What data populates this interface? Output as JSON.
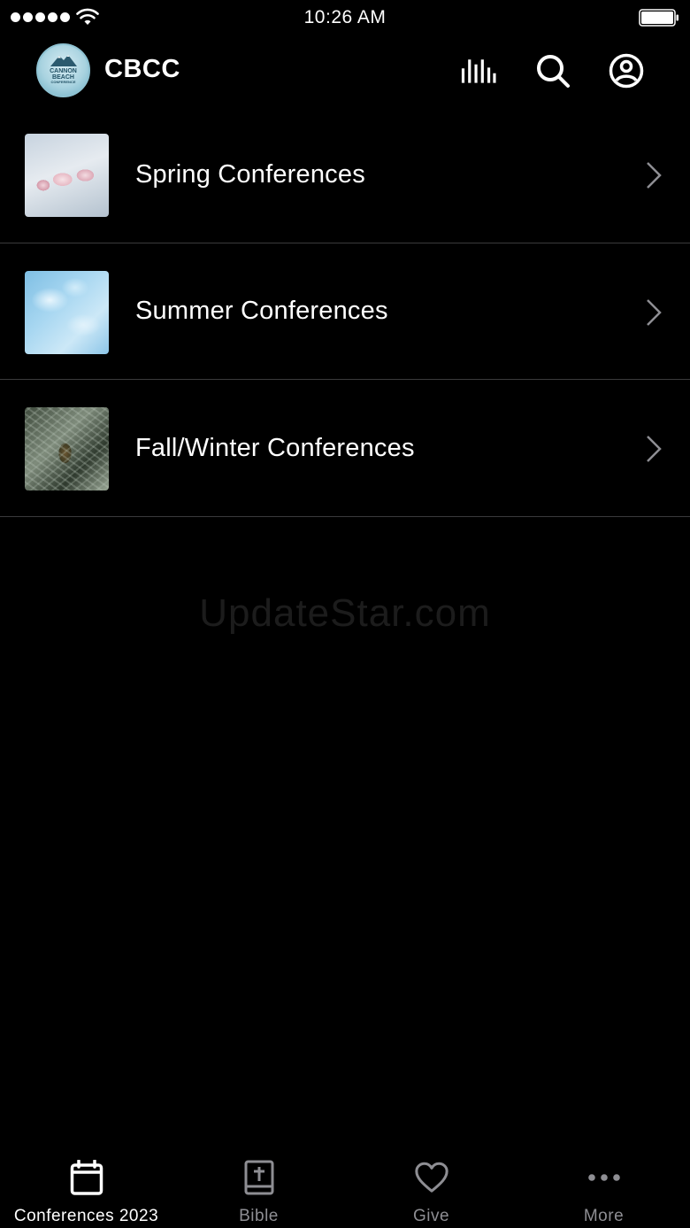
{
  "status_bar": {
    "time": "10:26 AM"
  },
  "header": {
    "title": "CBCC",
    "logo": {
      "line1": "CANNON",
      "line2": "BEACH",
      "line3": "CONFERENCE"
    }
  },
  "list": {
    "items": [
      {
        "label": "Spring Conferences",
        "thumbnail": "magnolia-blossoms"
      },
      {
        "label": "Summer Conferences",
        "thumbnail": "blue-frost"
      },
      {
        "label": "Fall/Winter Conferences",
        "thumbnail": "frosted-pine"
      }
    ]
  },
  "watermark": "UpdateStar.com",
  "tabbar": {
    "tabs": [
      {
        "label": "Conferences 2023",
        "icon": "calendar-icon",
        "active": true
      },
      {
        "label": "Bible",
        "icon": "bible-icon",
        "active": false
      },
      {
        "label": "Give",
        "icon": "heart-icon",
        "active": false
      },
      {
        "label": "More",
        "icon": "more-icon",
        "active": false
      }
    ]
  },
  "colors": {
    "background": "#000000",
    "text": "#ffffff",
    "inactive_tab": "#8e8e93",
    "separator": "#3a3a3c"
  }
}
